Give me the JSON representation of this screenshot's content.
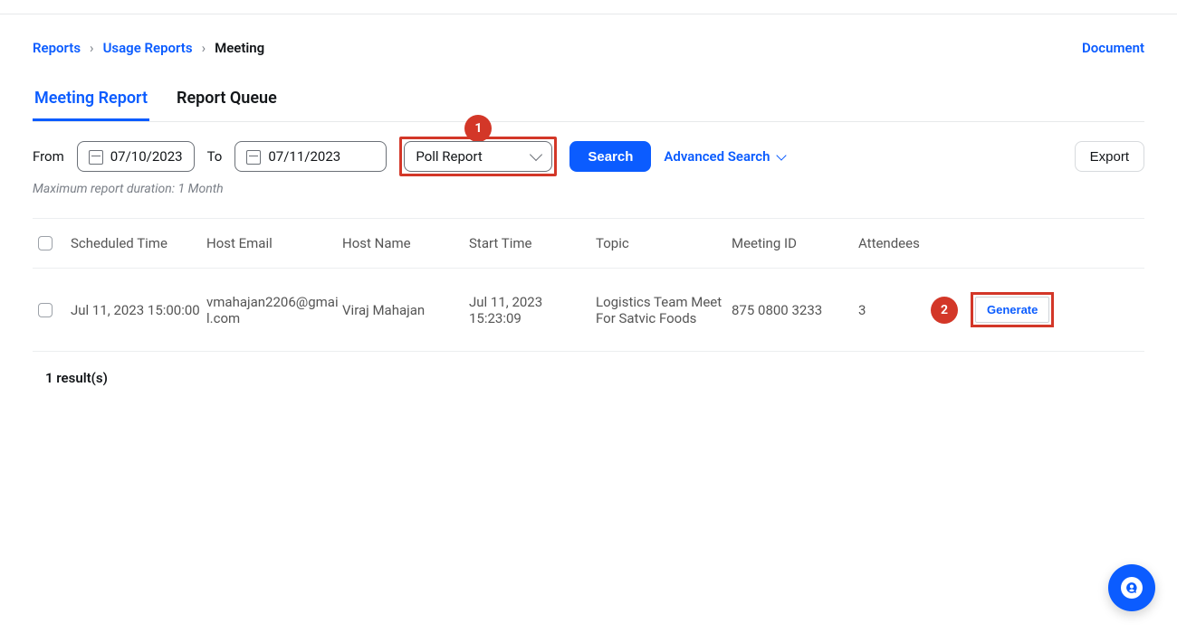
{
  "breadcrumb": {
    "root": "Reports",
    "mid": "Usage Reports",
    "current": "Meeting"
  },
  "document_link": "Document",
  "tabs": {
    "meeting_report": "Meeting Report",
    "report_queue": "Report Queue"
  },
  "filters": {
    "from_label": "From",
    "from_value": "07/10/2023",
    "to_label": "To",
    "to_value": "07/11/2023",
    "report_type_selected": "Poll Report",
    "search_label": "Search",
    "advanced_search_label": "Advanced Search",
    "export_label": "Export",
    "hint": "Maximum report duration: 1 Month"
  },
  "annotations": {
    "badge1": "1",
    "badge2": "2"
  },
  "table": {
    "headers": {
      "scheduled_time": "Scheduled Time",
      "host_email": "Host Email",
      "host_name": "Host Name",
      "start_time": "Start Time",
      "topic": "Topic",
      "meeting_id": "Meeting ID",
      "attendees": "Attendees"
    },
    "rows": [
      {
        "scheduled_time": "Jul 11, 2023 15:00:00",
        "host_email": "vmahajan2206@gmail.com",
        "host_name": "Viraj Mahajan",
        "start_time": "Jul 11, 2023 15:23:09",
        "topic": "Logistics Team Meet For Satvic Foods",
        "meeting_id": "875 0800 3233",
        "attendees": "3",
        "generate_label": "Generate"
      }
    ]
  },
  "result_count_text": "1 result(s)"
}
